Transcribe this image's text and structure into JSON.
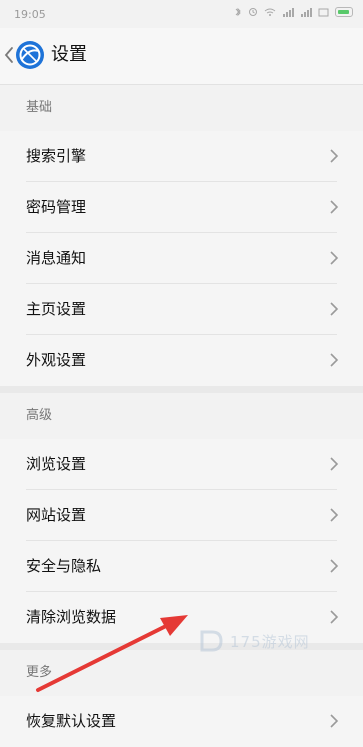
{
  "status_bar": {
    "time": "19:05",
    "battery_color": "#58c96a"
  },
  "header": {
    "title": "设置",
    "logo_color": "#1e73d8"
  },
  "sections": [
    {
      "title": "基础",
      "items": [
        "搜索引擎",
        "密码管理",
        "消息通知",
        "主页设置",
        "外观设置"
      ]
    },
    {
      "title": "高级",
      "items": [
        "浏览设置",
        "网站设置",
        "安全与隐私",
        "清除浏览数据"
      ]
    },
    {
      "title": "更多",
      "items": [
        "恢复默认设置"
      ]
    }
  ],
  "watermark": {
    "text": "175游戏网"
  },
  "annotation": {
    "arrow_color": "#e53935"
  }
}
